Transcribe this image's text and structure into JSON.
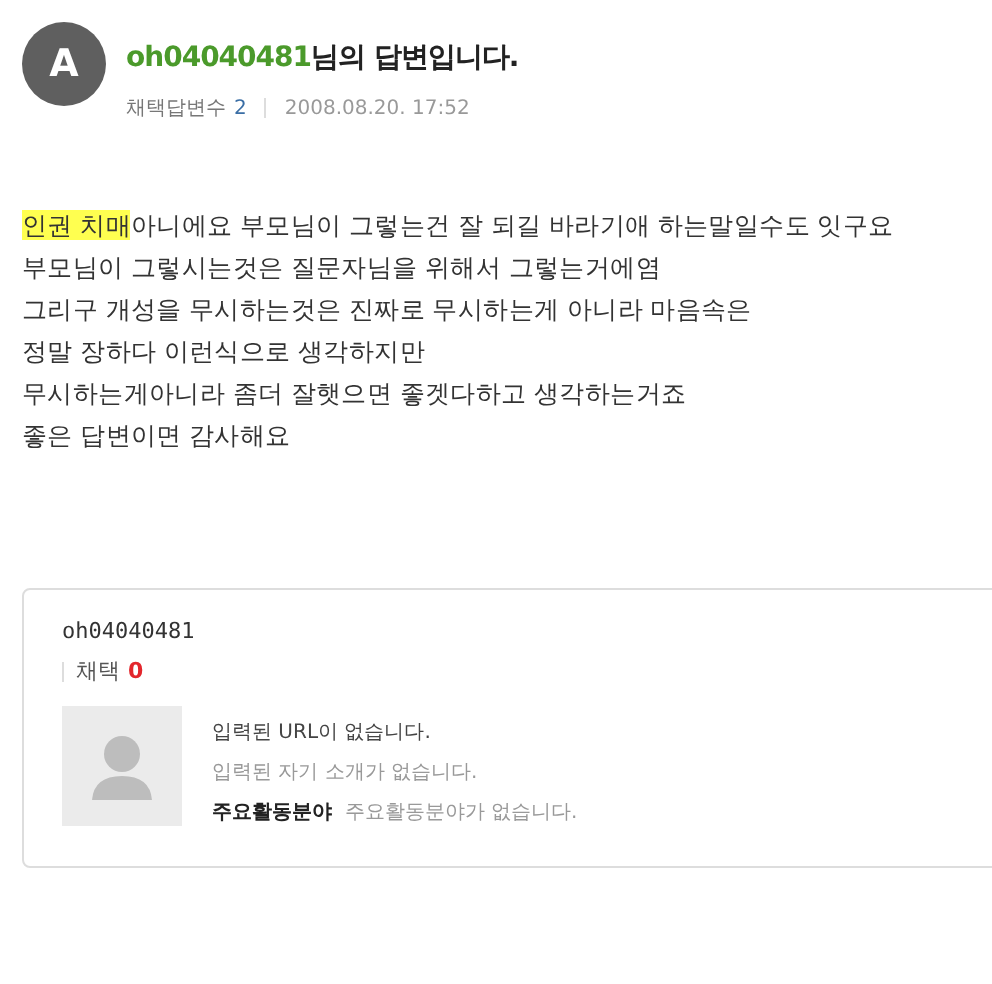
{
  "answer_header": {
    "avatar_letter": "A",
    "username": "oh04040481",
    "title_suffix": "님의 답변입니다.",
    "adopted_label": "채택답변수",
    "adopted_count": "2",
    "date": "2008.08.20. 17:52"
  },
  "body_lines": [
    {
      "segments": [
        {
          "text": "인권 치매",
          "highlighted": true
        },
        {
          "text": "아니에요 부모님이 그렇는건 잘 되길 바라기애 하는말일수도 잇구요",
          "highlighted": false
        }
      ]
    },
    {
      "segments": [
        {
          "text": "부모님이 그렇시는것은 질문자님을 위해서 그렇는거에염",
          "highlighted": false
        }
      ]
    },
    {
      "segments": [
        {
          "text": "그리구   개성을 무시하는것은   진짜로 무시하는게 아니라 마음속은",
          "highlighted": false
        }
      ]
    },
    {
      "segments": [
        {
          "text": "정말 장하다 이런식으로 생각하지만",
          "highlighted": false
        }
      ]
    },
    {
      "segments": [
        {
          "text": "무시하는게아니라 좀더 잘햇으면 좋겟다하고 생각하는거죠",
          "highlighted": false
        }
      ]
    },
    {
      "segments": [
        {
          "text": "좋은 답변이면 감사해요",
          "highlighted": false
        }
      ]
    }
  ],
  "profile_card": {
    "username": "oh04040481",
    "adopted_label": "채택",
    "adopted_count": "0",
    "url": "입력된 URL이 없습니다.",
    "intro": "입력된 자기 소개가 없습니다.",
    "field_label": "주요활동분야",
    "field_value": "주요활동분야가 없습니다."
  }
}
